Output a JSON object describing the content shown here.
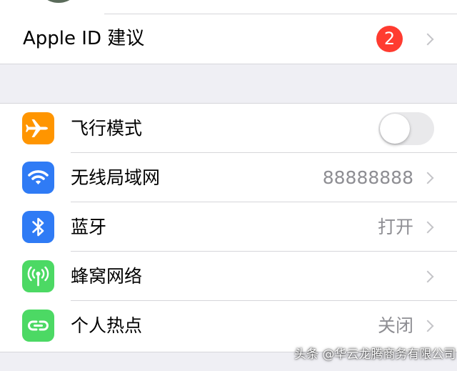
{
  "apple_id_row": {
    "label": "Apple ID 建议",
    "badge_count": "2",
    "badge_color": "#ff3b30"
  },
  "settings": [
    {
      "label": "飞行模式",
      "icon": "airplane-icon",
      "icon_color": "#ff9500",
      "control": "toggle",
      "toggle_on": false
    },
    {
      "label": "无线局域网",
      "icon": "wifi-icon",
      "icon_color": "#2f7bf5",
      "value": "88888888",
      "control": "chevron"
    },
    {
      "label": "蓝牙",
      "icon": "bluetooth-icon",
      "icon_color": "#2f7bf5",
      "value": "打开",
      "control": "chevron"
    },
    {
      "label": "蜂窝网络",
      "icon": "cellular-antenna-icon",
      "icon_color": "#4cd964",
      "control": "chevron"
    },
    {
      "label": "个人热点",
      "icon": "hotspot-link-icon",
      "icon_color": "#4cd964",
      "value": "关闭",
      "control": "chevron"
    }
  ],
  "watermark": {
    "text": "头条 @华云龙腾商务有限公司"
  }
}
